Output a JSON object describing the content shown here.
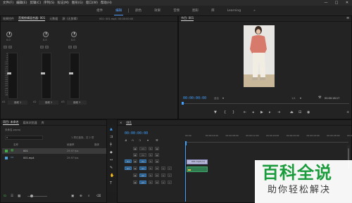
{
  "menubar": {
    "items": [
      "文件(F)",
      "编辑(E)",
      "剪辑(C)",
      "序列(S)",
      "标记(M)",
      "图形(G)",
      "窗口(W)",
      "帮助(H)"
    ],
    "controls": [
      "—",
      "□",
      "✕"
    ]
  },
  "workspace": {
    "tabs": [
      "组件",
      "编辑",
      "颜色",
      "效果",
      "音频",
      "图形",
      "库",
      "Learning"
    ],
    "active": "编辑",
    "overflow": "»"
  },
  "mixer": {
    "tabs": [
      "效果控件",
      "音频剪辑混合器: 001",
      "元数据",
      "源: (无剪辑)"
    ],
    "header_extra": "001: 001.mp4: 00:00:00:00",
    "channels": [
      {
        "id": "A1",
        "name": "音频 1",
        "value": "0.0"
      },
      {
        "id": "A2",
        "name": "音频 2",
        "value": "0.0"
      },
      {
        "id": "A3",
        "name": "音频 3",
        "value": "0.0"
      }
    ],
    "scale": [
      "0",
      "-3",
      "-6",
      "-9",
      "-12",
      "-15",
      "-18",
      "-21",
      "-24",
      "-27",
      "-30",
      "-33",
      "-36",
      "-39",
      "-42",
      "-45",
      "-48",
      "-51",
      "-54",
      "dB"
    ]
  },
  "program": {
    "title": "节目: 001",
    "timecode": "00:00:00:00",
    "fit": "适合",
    "quality": "1/4",
    "duration": "00:00:18:17"
  },
  "project": {
    "tabs": [
      "项目: 未命名",
      "媒体浏览器",
      "库"
    ],
    "file": "未命名.prproj",
    "search_placeholder": "",
    "count": "1 项已选择，共 2 项",
    "columns": [
      "名称",
      "帧速率",
      "媒体"
    ],
    "rows": [
      {
        "name": "001",
        "fps": "29.97 fps",
        "color": "#3fae42"
      },
      {
        "name": "001.mp4",
        "fps": "29.97 fps",
        "color": "#4aa0d8"
      }
    ]
  },
  "timeline": {
    "tab": "001",
    "timecode": "00:00:00:00",
    "ruler": [
      "00:00",
      "00:00:04:00",
      "00:00:08:00",
      "00:00:12:00",
      "00:00:16:00",
      "00:00:20:00",
      "00:00:24:00",
      "00:00:28:00",
      "00:00:32:00"
    ],
    "video_tracks": [
      "V3",
      "V2",
      "V1"
    ],
    "audio_tracks": [
      "A1",
      "A2",
      "A3"
    ],
    "clip_video": "001.mp4 [V]",
    "clip_audio": ""
  },
  "watermark": {
    "line1": "百科全说",
    "line2": "助你轻松解决"
  },
  "colors": {
    "accent": "#3fa0ff",
    "watermark_green": "#1a9b3c"
  }
}
